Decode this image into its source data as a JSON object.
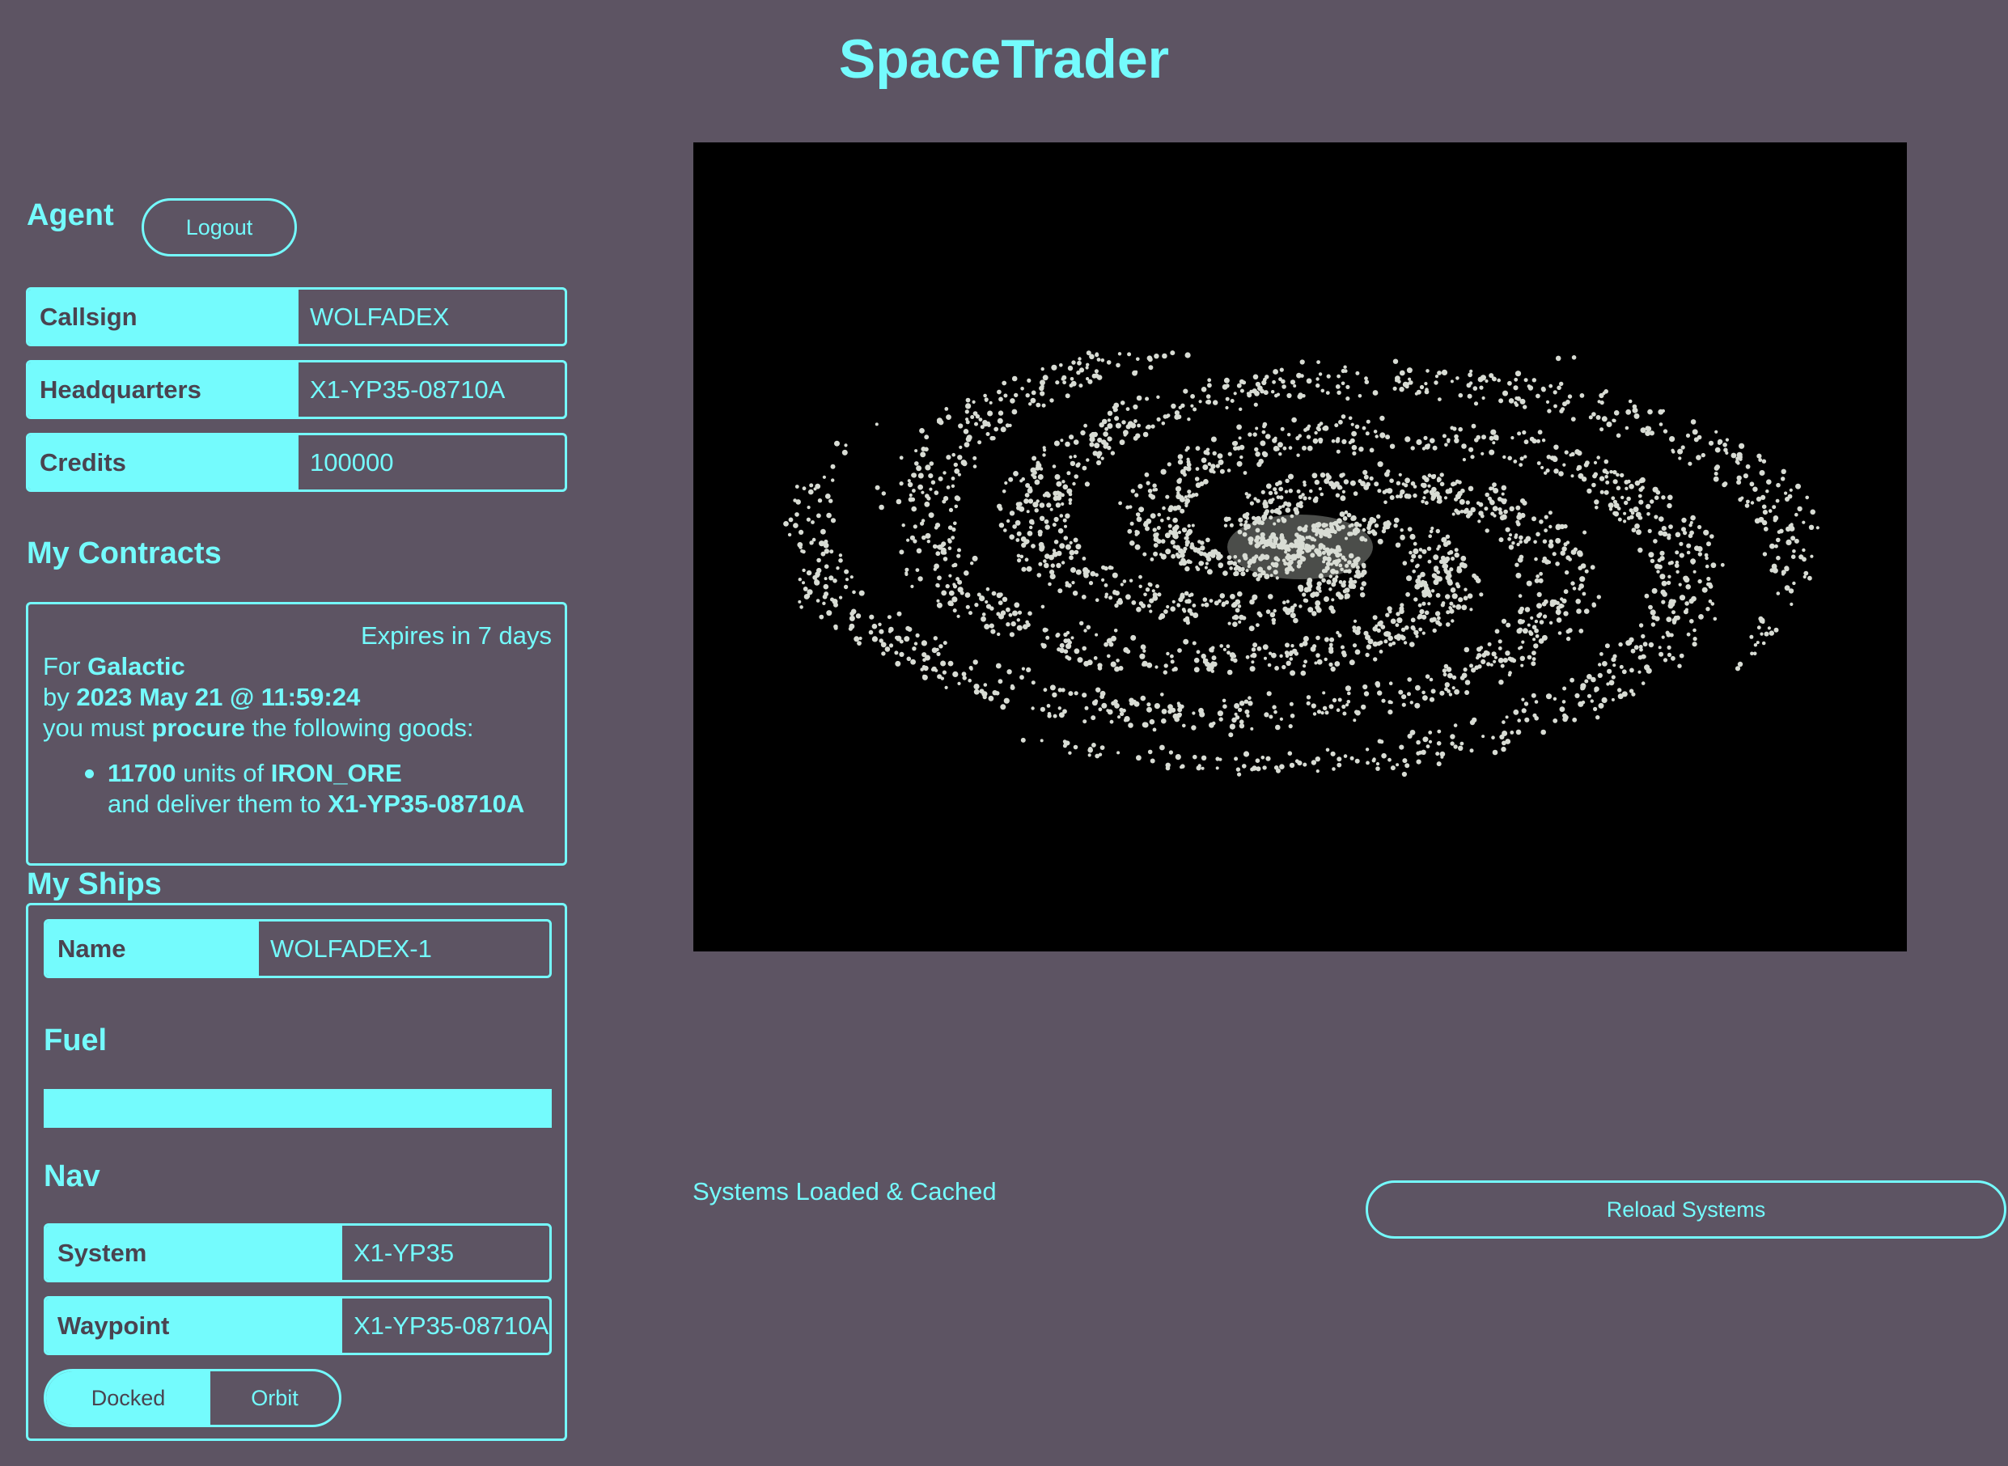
{
  "app": {
    "title": "SpaceTrader"
  },
  "agent": {
    "heading": "Agent",
    "logout_label": "Logout",
    "fields": [
      {
        "label": "Callsign",
        "value": "WOLFADEX"
      },
      {
        "label": "Headquarters",
        "value": "X1-YP35-08710A"
      },
      {
        "label": "Credits",
        "value": "100000"
      }
    ]
  },
  "contracts": {
    "heading": "My Contracts",
    "items": [
      {
        "expires": "Expires in 7 days",
        "for_prefix": "For",
        "faction": "Galactic",
        "by_prefix": "by",
        "deadline": "2023 May 21 @ 11:59:24",
        "must_prefix": "you must",
        "type": "procure",
        "must_suffix": "the following goods:",
        "deliver": [
          {
            "units": "11700",
            "units_of": "units of",
            "trade_symbol": "IRON_ORE",
            "deliver_prefix": "and deliver them to",
            "destination": "X1-YP35-08710A"
          }
        ]
      }
    ]
  },
  "ships": {
    "heading": "My Ships",
    "items": [
      {
        "name_label": "Name",
        "name": "WOLFADEX-1",
        "fuel_heading": "Fuel",
        "fuel_fraction": 1.0,
        "nav_heading": "Nav",
        "system_label": "System",
        "system": "X1-YP35",
        "waypoint_label": "Waypoint",
        "waypoint": "X1-YP35-08710A",
        "status_options": [
          "Docked",
          "Orbit"
        ],
        "status_selected": "Docked"
      }
    ]
  },
  "systems": {
    "status": "Systems Loaded & Cached",
    "reload_label": "Reload Systems"
  },
  "colors": {
    "background": "#5d5463",
    "accent": "#74fbfd",
    "star": "#d8dcd4",
    "map_bg": "#000000"
  }
}
